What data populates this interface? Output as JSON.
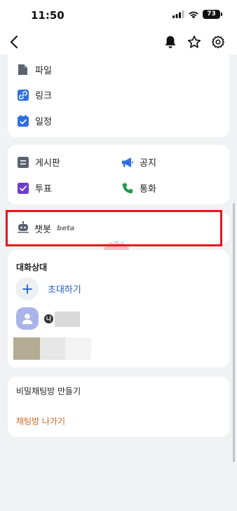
{
  "status_bar": {
    "time": "11:50",
    "battery": "73"
  },
  "menu_top": [
    {
      "label": "파일",
      "icon": "file-icon"
    },
    {
      "label": "링크",
      "icon": "link-icon"
    },
    {
      "label": "일정",
      "icon": "calendar-icon"
    }
  ],
  "board_items": {
    "board": "게시판",
    "notice": "공지",
    "vote": "투표",
    "call": "통화"
  },
  "chatbot": {
    "label": "챗봇",
    "badge": "beta"
  },
  "members": {
    "title": "대화상대",
    "invite_label": "초대하기",
    "me_badge": "나"
  },
  "bottom": {
    "secret_chat": "비밀채팅방 만들기",
    "leave_chat": "채팅방 나가기"
  },
  "watermark": {
    "text": "픽"
  },
  "colors": {
    "accent_blue": "#1f5fc9",
    "leave_orange": "#d4641b",
    "highlight_red": "#e8141b"
  }
}
